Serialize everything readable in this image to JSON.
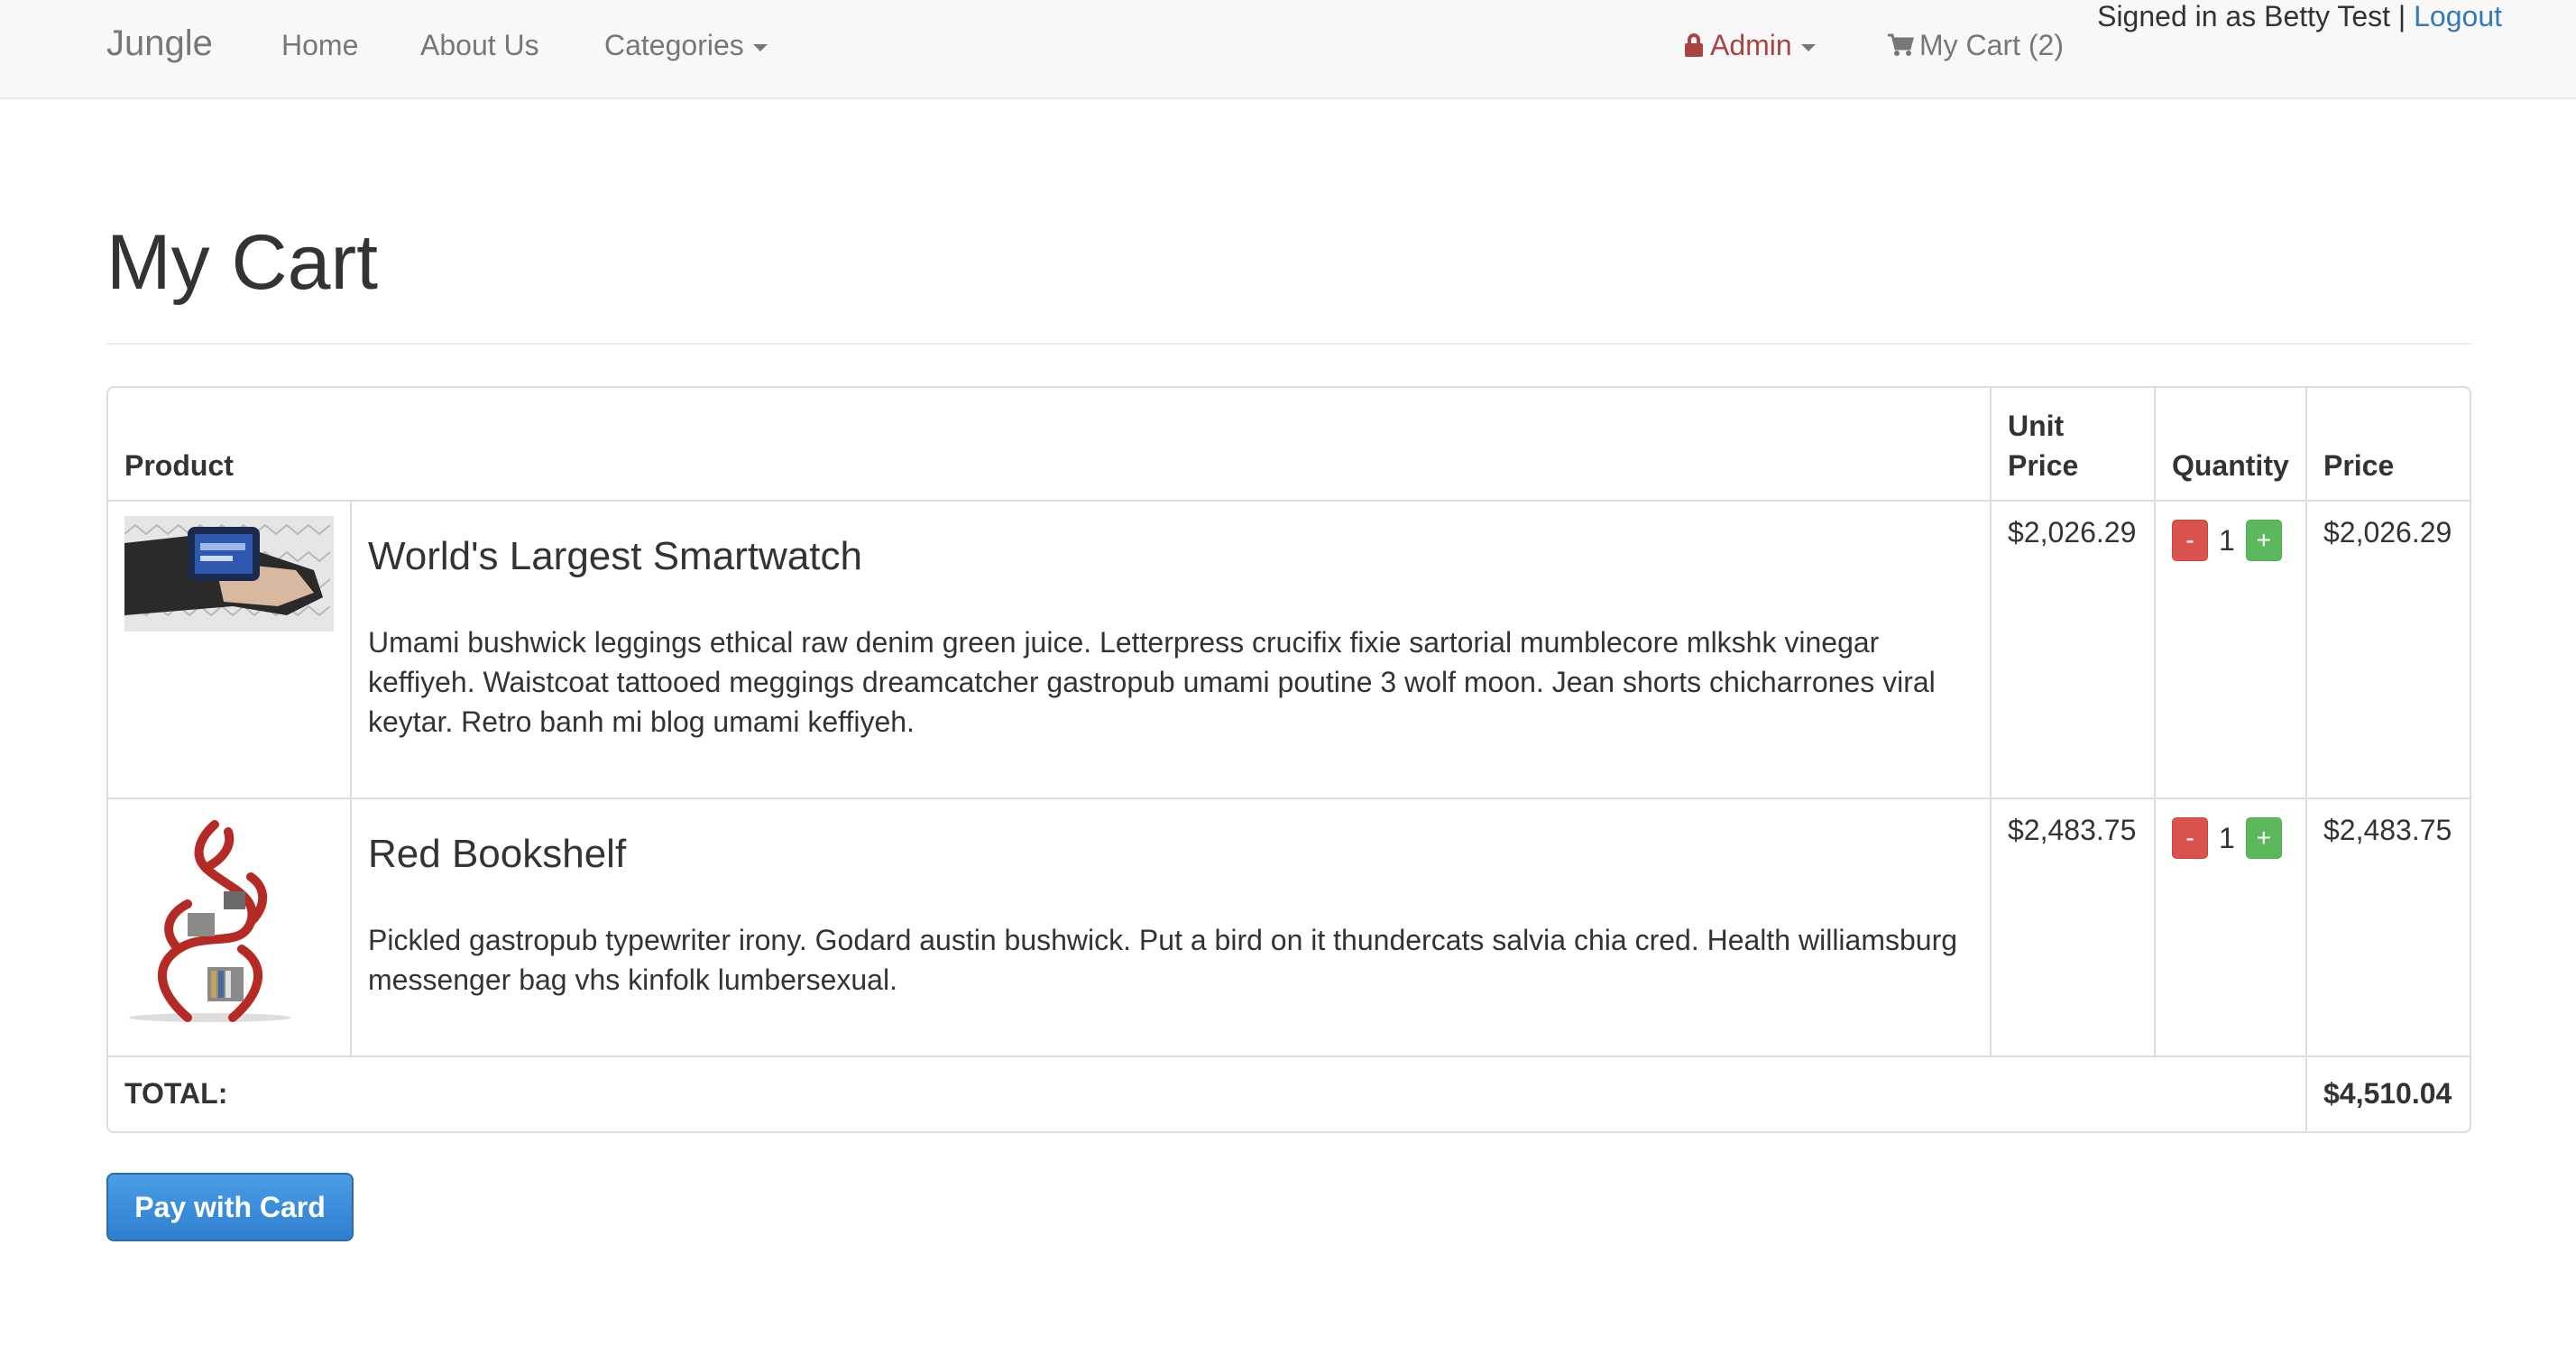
{
  "navbar": {
    "brand": "Jungle",
    "links": {
      "home": "Home",
      "about": "About Us",
      "categories": "Categories"
    },
    "admin": "Admin",
    "cart": "My Cart (2)",
    "signed_in_text": "Signed in as Betty Test |",
    "logout": "Logout"
  },
  "page": {
    "title": "My Cart"
  },
  "table": {
    "headers": {
      "product": "Product",
      "unit_price": "Unit Price",
      "quantity": "Quantity",
      "price": "Price"
    },
    "rows": [
      {
        "name": "World's Largest Smartwatch",
        "description": "Umami bushwick leggings ethical raw denim green juice. Letterpress crucifix fixie sartorial mumblecore mlkshk vinegar keffiyeh. Waistcoat tattooed meggings dreamcatcher gastropub umami poutine 3 wolf moon. Jean shorts chicharrones viral keytar. Retro banh mi blog umami keffiyeh.",
        "unit_price": "$2,026.29",
        "quantity": "1",
        "price": "$2,026.29",
        "minus": "-",
        "plus": "+"
      },
      {
        "name": "Red Bookshelf",
        "description": "Pickled gastropub typewriter irony. Godard austin bushwick. Put a bird on it thundercats salvia chia cred. Health williamsburg messenger bag vhs kinfolk lumbersexual.",
        "unit_price": "$2,483.75",
        "quantity": "1",
        "price": "$2,483.75",
        "minus": "-",
        "plus": "+"
      }
    ],
    "total_label": "TOTAL:",
    "total_value": "$4,510.04"
  },
  "pay_button": "Pay with Card",
  "colors": {
    "navbar_bg": "#f8f8f8",
    "admin_red": "#a94442",
    "link_blue": "#337ab7",
    "minus_red": "#d9534f",
    "plus_green": "#5cb85c",
    "pay_blue": "#337ab7"
  },
  "icons": [
    "lock-icon",
    "shopping-cart-icon",
    "caret-down-icon"
  ]
}
